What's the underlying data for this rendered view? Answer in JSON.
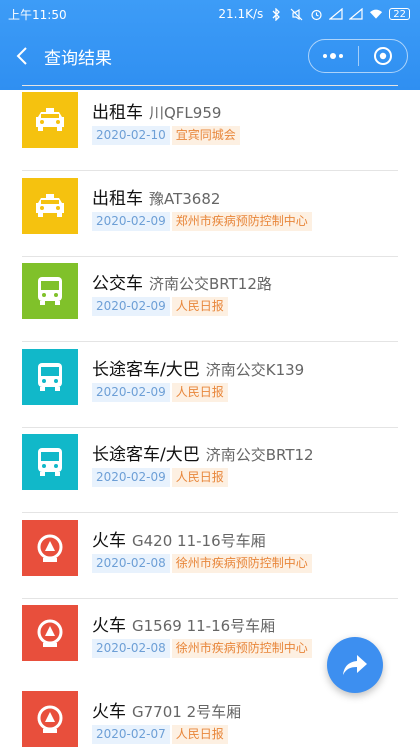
{
  "status_bar": {
    "time": "上午11:50",
    "network_speed": "21.1K/s",
    "battery": "22"
  },
  "nav": {
    "title": "查询结果"
  },
  "colors": {
    "header_blue": "#3d9cf7",
    "taxi_yellow": "#f5c20f",
    "bus_green": "#80c12a",
    "coach_teal": "#11b8c9",
    "train_red": "#e84f3c",
    "fab_blue": "#3d8ff0"
  },
  "records": [
    {
      "kind": "出租车",
      "number": "川QFL959",
      "date": "2020-02-10",
      "source": "宜宾同城会",
      "icon": "taxi-icon"
    },
    {
      "kind": "出租车",
      "number": "豫AT3682",
      "date": "2020-02-09",
      "source": "郑州市疾病预防控制中心",
      "icon": "taxi-icon"
    },
    {
      "kind": "公交车",
      "number": "济南公交BRT12路",
      "date": "2020-02-09",
      "source": "人民日报",
      "icon": "bus-icon"
    },
    {
      "kind": "长途客车/大巴",
      "number": "济南公交K139",
      "date": "2020-02-09",
      "source": "人民日报",
      "icon": "coach-icon"
    },
    {
      "kind": "长途客车/大巴",
      "number": "济南公交BRT12",
      "date": "2020-02-09",
      "source": "人民日报",
      "icon": "coach-icon"
    },
    {
      "kind": "火车",
      "number": "G420 11-16号车厢",
      "date": "2020-02-08",
      "source": "徐州市疾病预防控制中心",
      "icon": "train-icon"
    },
    {
      "kind": "火车",
      "number": "G1569 11-16号车厢",
      "date": "2020-02-08",
      "source": "徐州市疾病预防控制中心",
      "icon": "train-icon"
    },
    {
      "kind": "火车",
      "number": "G7701 2号车厢",
      "date": "2020-02-07",
      "source": "人民日报",
      "icon": "train-icon"
    }
  ]
}
